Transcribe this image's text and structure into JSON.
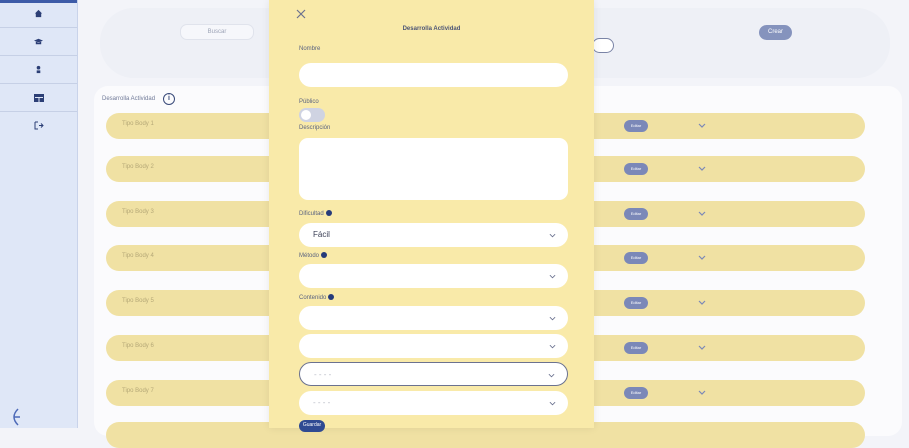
{
  "header": {
    "search_placeholder": "Buscar",
    "crear_label": "Crear"
  },
  "panel": {
    "title": "Desarrolla Actividad",
    "rows": [
      {
        "label": "Tipo Body 1",
        "pill": "Editar"
      },
      {
        "label": "Tipo Body 2",
        "pill": "Editar"
      },
      {
        "label": "Tipo Body 3",
        "pill": "Editar"
      },
      {
        "label": "Tipo Body 4",
        "pill": "Editar"
      },
      {
        "label": "Tipo Body 5",
        "pill": "Editar"
      },
      {
        "label": "Tipo Body 6",
        "pill": "Editar"
      },
      {
        "label": "Tipo Body 7",
        "pill": "Editar"
      }
    ]
  },
  "modal": {
    "title": "Desarrolla Actividad",
    "fields": {
      "nombre_label": "Nombre",
      "publico_label": "Público",
      "descripcion_label": "Descripción",
      "dificultad_label": "Dificultad",
      "dificultad_value": "Fácil",
      "metodo_label": "Método",
      "contenido_label": "Contenido",
      "placeholder_dashes": "- - - -"
    },
    "save_label": "Guardar"
  },
  "sidebar": {
    "icons": [
      "home-icon",
      "graduation-icon",
      "user-icon",
      "table-icon",
      "logout-icon"
    ]
  }
}
